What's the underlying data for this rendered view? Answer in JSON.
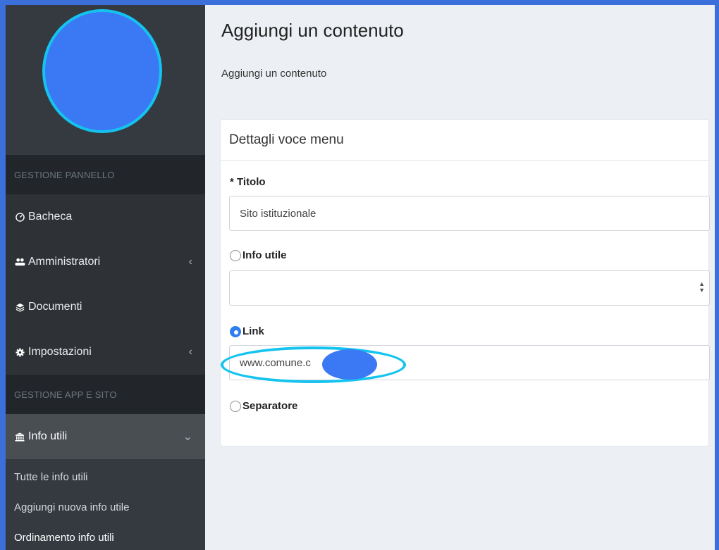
{
  "sidebar": {
    "section_panel": "GESTIONE PANNELLO",
    "items": [
      {
        "label": "Bacheca",
        "icon": "dashboard-icon"
      },
      {
        "label": "Amministratori",
        "icon": "users-icon",
        "chevron": "‹"
      },
      {
        "label": "Documenti",
        "icon": "layers-icon"
      },
      {
        "label": "Impostazioni",
        "icon": "gear-icon",
        "chevron": "‹"
      }
    ],
    "section_app": "GESTIONE APP E SITO",
    "active_item": {
      "label": "Info utili",
      "icon": "bank-icon",
      "chevron": "⌄"
    },
    "submenu": [
      {
        "label": "Tutte le info utili"
      },
      {
        "label": "Aggiungi nuova info utile"
      },
      {
        "label": "Ordinamento info utili"
      }
    ]
  },
  "main": {
    "title": "Aggiungi un contenuto",
    "breadcrumb": "Aggiungi un contenuto",
    "card": {
      "header": "Dettagli voce menu",
      "titolo_label": "* Titolo",
      "titolo_value": "Sito istituzionale",
      "info_utile_label": "Info utile",
      "link_label": "Link",
      "link_value": "www.comune.c            .it",
      "separatore_label": "Separatore"
    }
  },
  "colors": {
    "sidebar_bg": "#343a40",
    "accent_blue": "#2f7ef0",
    "highlight_cyan": "#14c3ef",
    "page_bg": "#eceff3"
  }
}
